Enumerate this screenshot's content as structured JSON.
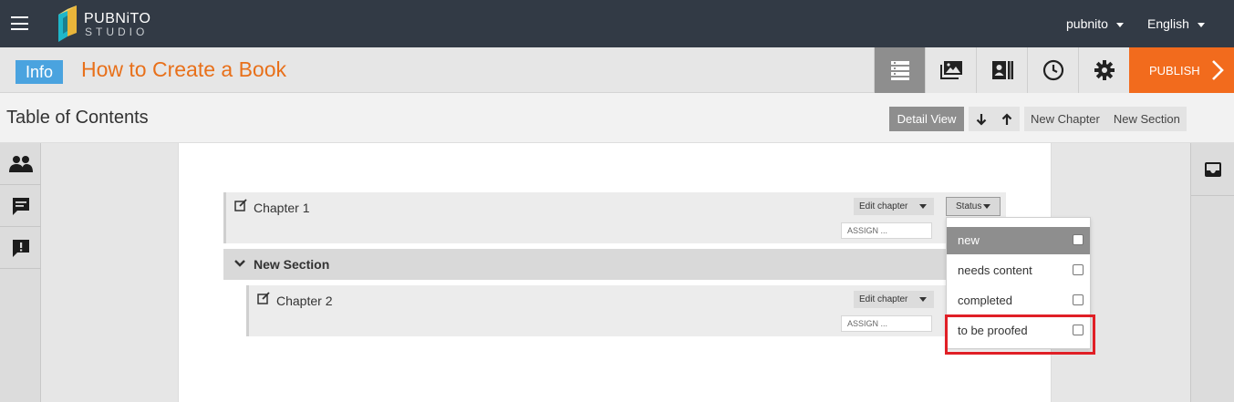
{
  "app": {
    "logo_name": "PUBNiTO",
    "logo_sub": "STUDIO",
    "user": "pubnito",
    "language": "English"
  },
  "titlebar": {
    "badge": "Info",
    "book_title": "How to Create a Book",
    "tools": [
      "list-icon",
      "images-icon",
      "contacts-icon",
      "history-icon",
      "settings-icon"
    ],
    "publish": "PUBLISH"
  },
  "toc": {
    "title": "Table of Contents",
    "detail_view": "Detail View",
    "new_chapter": "New Chapter",
    "new_section": "New Section"
  },
  "content": {
    "chapter1": {
      "label": "Chapter 1",
      "edit": "Edit chapter",
      "assign_placeholder": "ASSIGN ...",
      "status": "Status"
    },
    "section": {
      "label": "New Section"
    },
    "chapter2": {
      "label": "Chapter 2",
      "edit": "Edit chapter",
      "assign_placeholder": "ASSIGN ..."
    }
  },
  "status_menu": {
    "items": [
      {
        "label": "new",
        "selected": true
      },
      {
        "label": "needs content",
        "selected": false
      },
      {
        "label": "completed",
        "selected": false
      },
      {
        "label": "to be proofed",
        "selected": false
      }
    ]
  },
  "colors": {
    "topbar": "#323a45",
    "accent_orange": "#f26b1d",
    "title_orange": "#e8701a",
    "info_blue": "#4aa3df",
    "highlight_red": "#e01f26"
  }
}
